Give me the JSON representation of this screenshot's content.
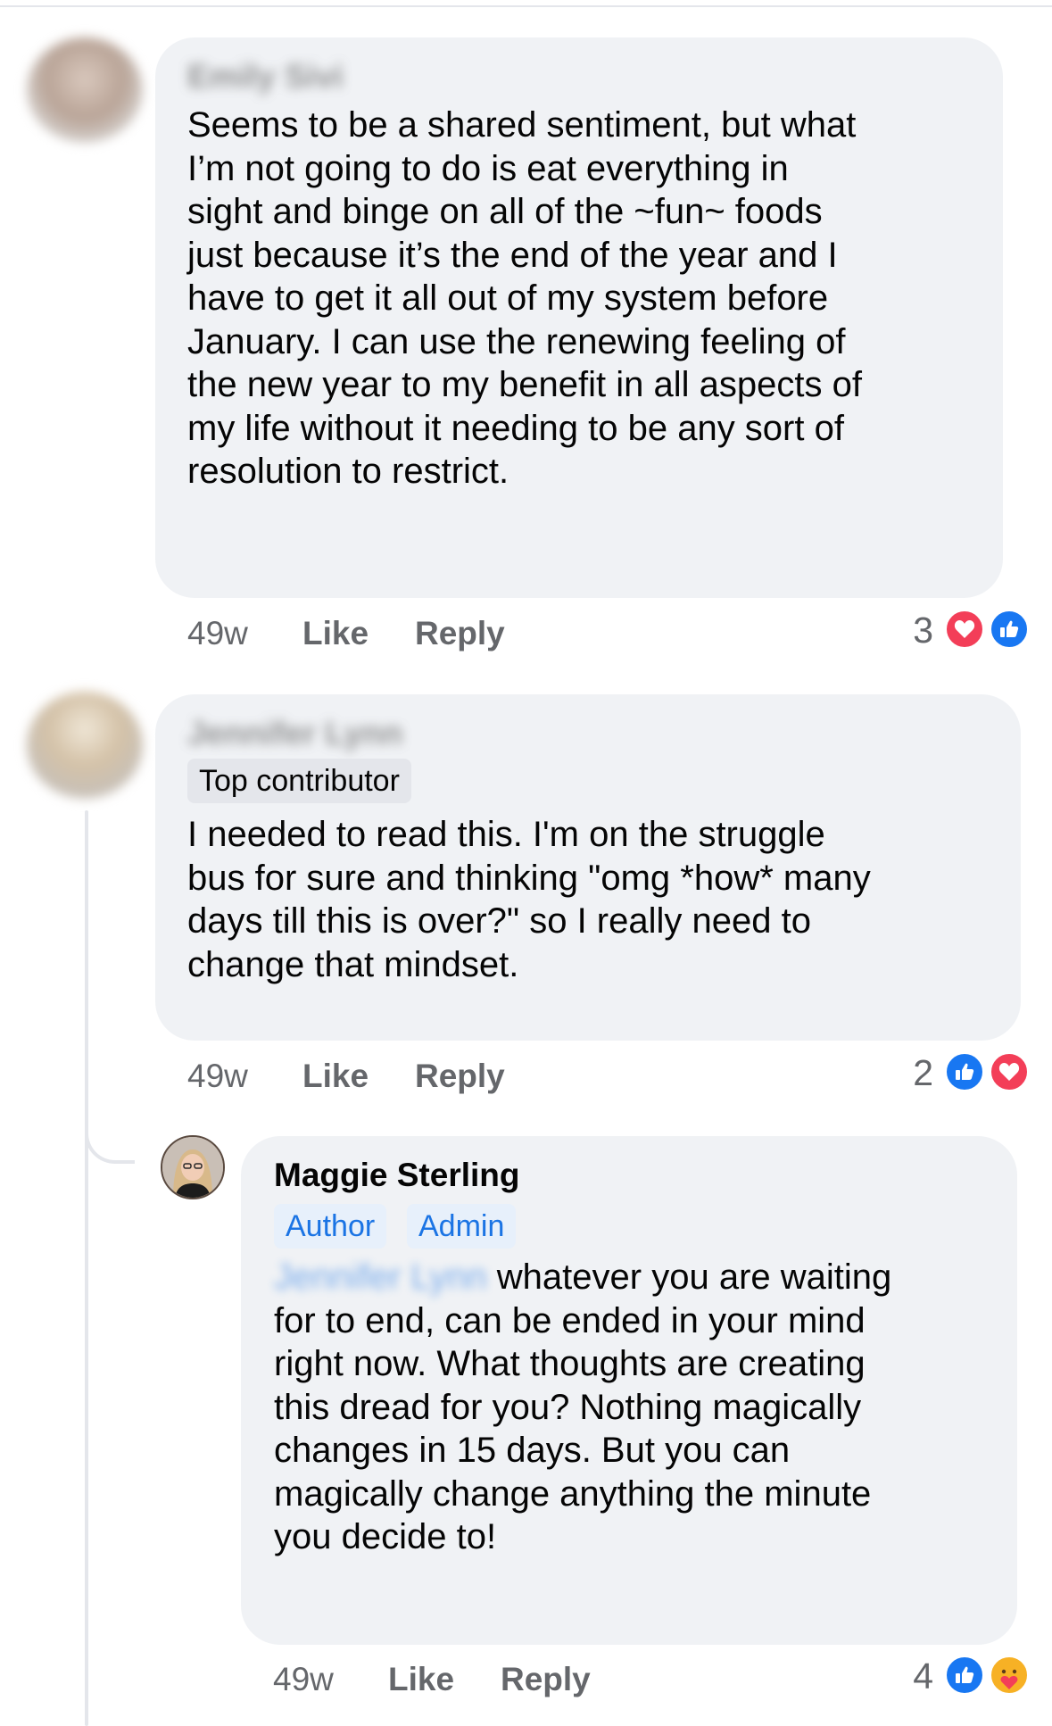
{
  "colors": {
    "bubble": "#f0f2f5",
    "meta_gray": "#65676b",
    "like_blue": "#1877f2",
    "love_red": "#f33e58",
    "care_yellow": "#f7b125",
    "badge_blue_text": "#1b74e4"
  },
  "comments": [
    {
      "author": "Emily Sivi",
      "text_lines": [
        "Seems to be a shared sentiment, but what",
        "I’m not going to do is eat everything in",
        "sight and binge on all of the ~fun~ foods",
        "just because it’s the end of the year and I",
        "have to get it all out of my system before",
        "January. I can use the renewing feeling of",
        "the new year to my benefit in all aspects of",
        "my life without it needing to be any sort of",
        "resolution to restrict."
      ],
      "time": "49w",
      "like_label": "Like",
      "reply_label": "Reply",
      "reaction_count": "3",
      "reactions": [
        "love-icon",
        "like-icon"
      ]
    },
    {
      "author": "Jennifer Lynn",
      "badge": "Top contributor",
      "text_lines": [
        "I needed to read this. I'm on the struggle",
        "bus for sure and thinking \"omg *how* many",
        "days till this is over?\" so I really need to",
        "change that mindset."
      ],
      "time": "49w",
      "like_label": "Like",
      "reply_label": "Reply",
      "reaction_count": "2",
      "reactions": [
        "like-icon",
        "love-icon"
      ]
    },
    {
      "author": "Maggie Sterling",
      "badges": [
        "Author",
        "Admin"
      ],
      "mention": "Jennifer Lynn",
      "text_first_line_rest": "whatever you are waiting",
      "text_lines": [
        "for to end, can be ended in your mind",
        "right now. What thoughts are creating",
        "this dread for you? Nothing magically",
        "changes in 15 days. But you can",
        "magically change anything the minute",
        "you decide to!"
      ],
      "time": "49w",
      "like_label": "Like",
      "reply_label": "Reply",
      "reaction_count": "4",
      "reactions": [
        "like-icon",
        "care-icon"
      ]
    }
  ]
}
